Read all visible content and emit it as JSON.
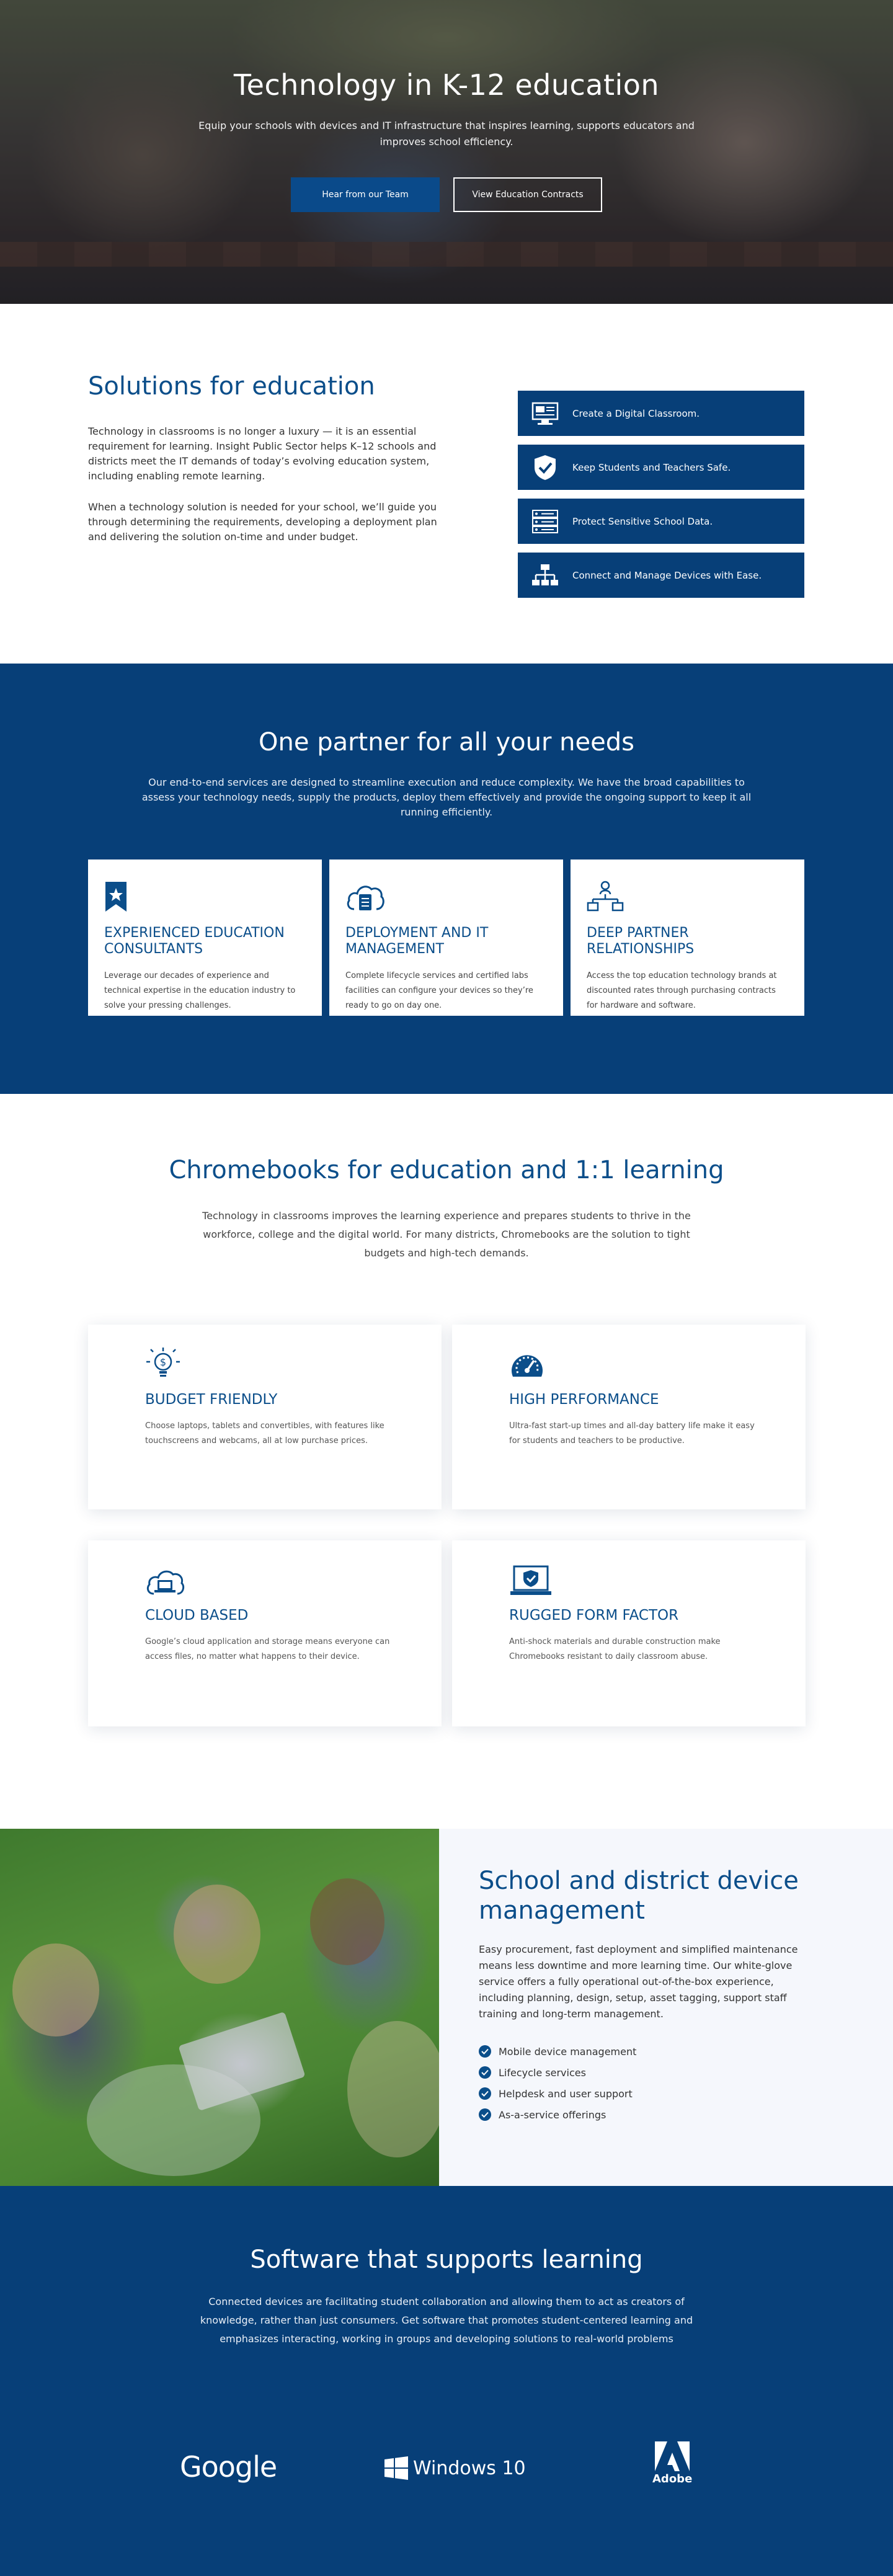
{
  "hero": {
    "title": "Technology in K-12 education",
    "subtitle": "Equip your schools with devices and IT infrastructure that inspires learning, supports educa­tors and improves school efficiency.",
    "primary_button": "Hear from our Team",
    "secondary_button": "View Education Contracts"
  },
  "solutions": {
    "title": "Solutions for education",
    "paragraphs": [
      "Technology in classrooms is no longer a luxury — it is an essen­tial requirement for learning. Insight Public Sector helps K–12 schools and districts meet the IT demands of today’s evolving education system, including enabling remote learning.",
      "When a technology solution is needed for your school, we’ll guide you through determining the requirements, developing a deployment plan and delivering the solution on-time and under budget."
    ],
    "items": [
      {
        "label": "Create a Digital Classroom.",
        "icon": "monitor-icon"
      },
      {
        "label": "Keep Students and Teachers Safe.",
        "icon": "shield-check-icon"
      },
      {
        "label": "Protect Sensitive School Data.",
        "icon": "server-rack-icon"
      },
      {
        "label": "Connect and Manage Devices with Ease.",
        "icon": "network-icon"
      }
    ]
  },
  "partner": {
    "title": "One partner for all your needs",
    "subtitle": "Our end-to-end services are designed to streamline execution and reduce complexity. We have the broad capa­bilities to assess your technology needs, supply the products, deploy them effectively and provide the ongoing support to keep it all running efficiently.",
    "cards": [
      {
        "title": "Experienced education consultants",
        "text": "Leverage our decades of experience and technical expertise in the education industry to solve your pressing challenges.",
        "icon": "bookmark-star-icon"
      },
      {
        "title": "Deployment and IT management",
        "text": "Complete lifecycle services and certified labs facilities can configure your devices so they’re ready to go on day one.",
        "icon": "cloud-server-icon"
      },
      {
        "title": "Deep partner relationships",
        "text": "Access the top education technology brands at discounted rates through purchasing contracts for hardware and software.",
        "icon": "org-chart-icon"
      }
    ]
  },
  "chromebooks": {
    "title": "Chromebooks for education and 1:1 learning",
    "subtitle": "Technology in classrooms improves the learning experience and prepares students to thrive in the workforce, college and the digital world. For many districts, Chromebooks are the solu­tion to tight budgets and high-tech demands.",
    "cards": [
      {
        "title": "Budget friendly",
        "text": "Choose laptops, tablets and convertibles, with features like touchscreens and webcams, all at low purchase prices.",
        "icon": "lightbulb-dollar-icon"
      },
      {
        "title": "High performance",
        "text": "Ultra-fast start-up times and all-day battery life make it easy for students and teachers to be productive.",
        "icon": "speedometer-icon"
      },
      {
        "title": "Cloud based",
        "text": "Google’s cloud application and storage means everyone can access files, no matter what happens to their device.",
        "icon": "cloud-laptop-icon"
      },
      {
        "title": "Rugged form factor",
        "text": "Anti-shock materials and durable construction make Chromebooks resistant to daily classroom abuse.",
        "icon": "laptop-shield-icon"
      }
    ]
  },
  "device": {
    "title": "School and district device management",
    "paragraph": "Easy procurement, fast deployment and simplified main­tenance means less downtime and more learning time. Our white-glove service offers a fully operational out-of-the-box experience, including planning, design, setup, asset tagging, support staff training and long-term management.",
    "list": [
      "Mobile device management",
      "Lifecycle services",
      "Helpdesk and user support",
      "As-a-service offerings"
    ]
  },
  "software": {
    "title": "Software that supports learning",
    "subtitle": "Connected devices are facilitating student collaboration and allowing them to act as cre­ators of knowledge, rather than just consumers. Get software that promotes student-cen­tered learning and emphasizes interacting, working in groups and developing solutions to real-world problems",
    "logos": {
      "google": "Google",
      "windows": "Windows 10",
      "adobe": "Adobe"
    }
  },
  "colors": {
    "brand_blue": "#073f78",
    "heading_blue": "#0b4e8a",
    "white": "#ffffff"
  }
}
